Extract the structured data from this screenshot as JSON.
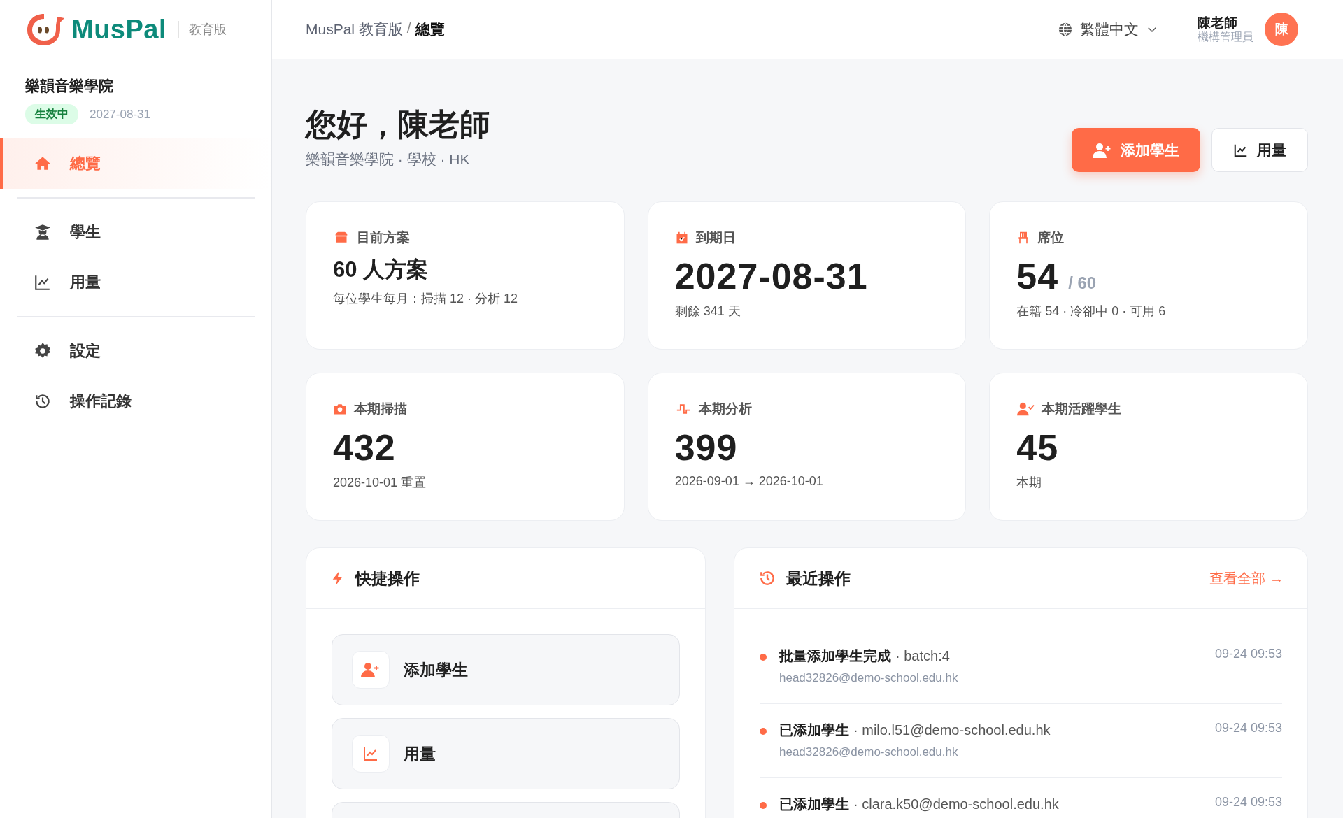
{
  "header": {
    "brand": "MusPal",
    "edition": "教育版",
    "breadcrumb": {
      "parent": "MusPal 教育版",
      "separator": "/",
      "current": "總覽"
    },
    "language": "繁體中文",
    "user": {
      "name": "陳老師",
      "role": "機構管理員",
      "avatar": "陳"
    }
  },
  "sidebar": {
    "school": "樂韻音樂學院",
    "status": "生效中",
    "expiry": "2027-08-31",
    "groups": [
      [
        {
          "label": "總覽",
          "kind": "home",
          "selected": true
        }
      ],
      [
        {
          "label": "學生",
          "kind": "students",
          "selected": false
        },
        {
          "label": "用量",
          "kind": "usage",
          "selected": false
        }
      ],
      [
        {
          "label": "設定",
          "kind": "settings",
          "selected": false
        },
        {
          "label": "操作記錄",
          "kind": "history",
          "selected": false
        }
      ]
    ]
  },
  "greeting": {
    "title": "您好，陳老師",
    "subtitle": "樂韻音樂學院 · 學校 · HK"
  },
  "actions": [
    {
      "label": "添加學生",
      "kind": "primary"
    },
    {
      "label": "用量",
      "kind": "secondary"
    }
  ],
  "cards": [
    {
      "kind": "plan",
      "label": "目前方案",
      "value": "60 人方案",
      "note": "每位學生每月：掃描 12 · 分析 12"
    },
    {
      "kind": "expiry",
      "label": "到期日",
      "value": "2027-08-31",
      "note": "剩餘 341 天"
    },
    {
      "kind": "seats",
      "label": "席位",
      "value": "54",
      "suffix": "/ 60",
      "note": "在籍 54 · 冷卻中 0 · 可用 6"
    },
    {
      "kind": "scans",
      "label": "本期掃描",
      "value": "432",
      "note": "2026-10-01 重置"
    },
    {
      "kind": "analyses",
      "label": "本期分析",
      "value": "399",
      "note": "2026-09-01 → 2026-10-01"
    },
    {
      "kind": "active",
      "label": "本期活躍學生",
      "value": "45",
      "note": "本期"
    }
  ],
  "quick": {
    "title": "快捷操作",
    "items": [
      {
        "label": "添加學生",
        "kind": "add-student"
      },
      {
        "label": "用量",
        "kind": "usage"
      },
      {
        "kind": "blank"
      }
    ]
  },
  "recent": {
    "title": "最近操作",
    "link": "查看全部 →",
    "items": [
      {
        "action": "批量添加學生完成",
        "detail": "· batch:4",
        "actor": "head32826@demo-school.edu.hk",
        "time": "09-24 09:53",
        "color": "#ff6b47"
      },
      {
        "action": "已添加學生",
        "detail": "· milo.l51@demo-school.edu.hk",
        "actor": "head32826@demo-school.edu.hk",
        "time": "09-24 09:53",
        "color": "#ff6b47"
      },
      {
        "action": "已添加學生",
        "detail": "· clara.k50@demo-school.edu.hk",
        "time": "09-24 09:53",
        "color": "#ff6b47"
      }
    ]
  }
}
